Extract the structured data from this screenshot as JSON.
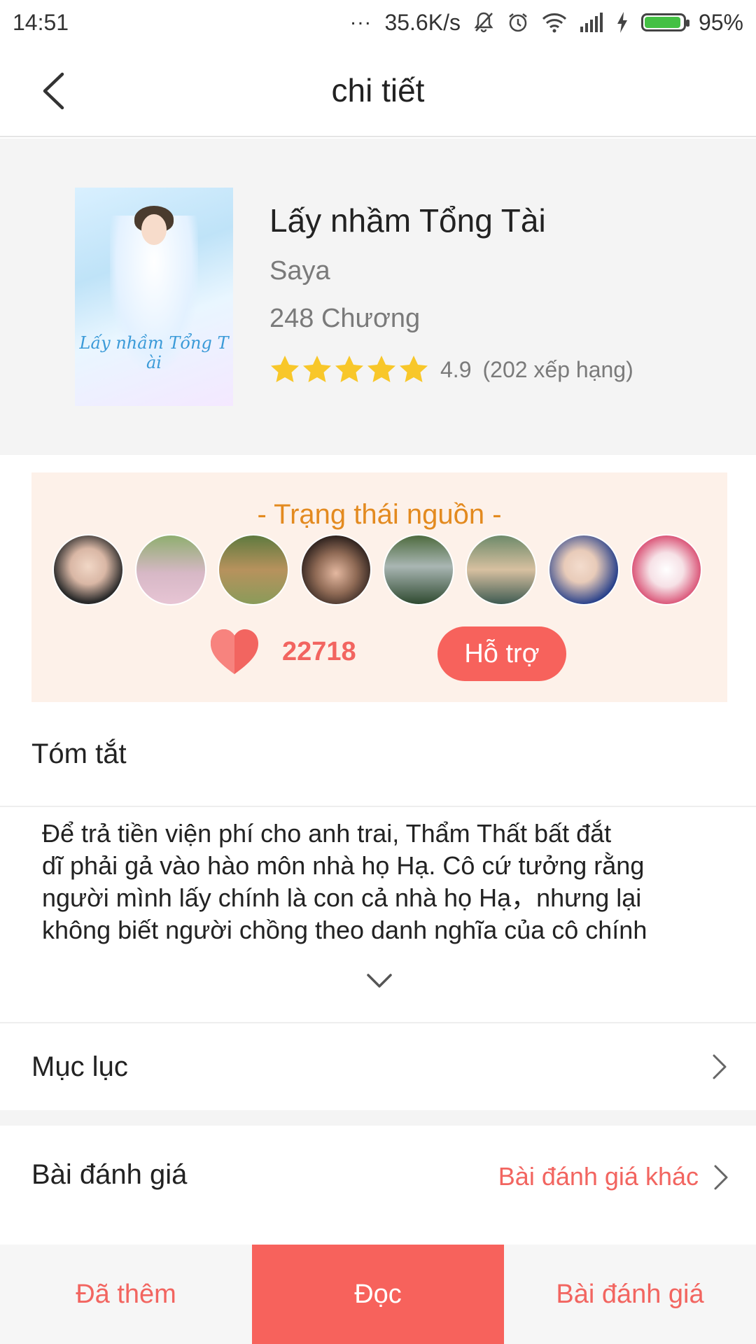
{
  "status_bar": {
    "time": "14:51",
    "dots": "...",
    "network_speed": "35.6K/s",
    "battery_percent": "95%",
    "battery_level": 0.95,
    "icons": [
      "mute-bell-icon",
      "alarm-icon",
      "wifi-icon",
      "signal-icon",
      "charging-icon",
      "battery-icon"
    ]
  },
  "header": {
    "title": "chi tiết",
    "back_icon": "chevron-left-icon"
  },
  "book": {
    "cover_title": "Lấy nhầm Tổng T ài",
    "title": "Lấy nhầm Tổng Tài",
    "author": "Saya",
    "chapters": "248 Chương",
    "stars": 5,
    "rating": "4.9",
    "rating_count": "(202 xếp hạng)"
  },
  "support": {
    "title": "- Trạng thái nguồn -",
    "avatar_count": 8,
    "likes": "22718",
    "button_label": "Hỗ trợ"
  },
  "summary": {
    "label": "Tóm tắt",
    "lines": [
      "Để trả tiền viện phí cho anh trai, Thẩm Thất bất đắt",
      "dĩ phải gả vào hào môn nhà họ Hạ. Cô cứ tưởng rằng",
      "người mình lấy chính là con cả nhà họ Hạ，nhưng lại",
      "không biết người chồng theo danh nghĩa của cô chính"
    ]
  },
  "toc": {
    "label": "Mục lục"
  },
  "reviews": {
    "label": "Bài đánh giá",
    "more_link": "Bài đánh giá khác"
  },
  "bottom_bar": {
    "added": "Đã thêm",
    "read": "Đọc",
    "review": "Bài đánh giá"
  },
  "colors": {
    "accent": "#f7625c",
    "accent_text": "#f26560",
    "support_title": "#e38a1f",
    "support_bg": "#fdf1e9",
    "star": "#f8c72a"
  }
}
